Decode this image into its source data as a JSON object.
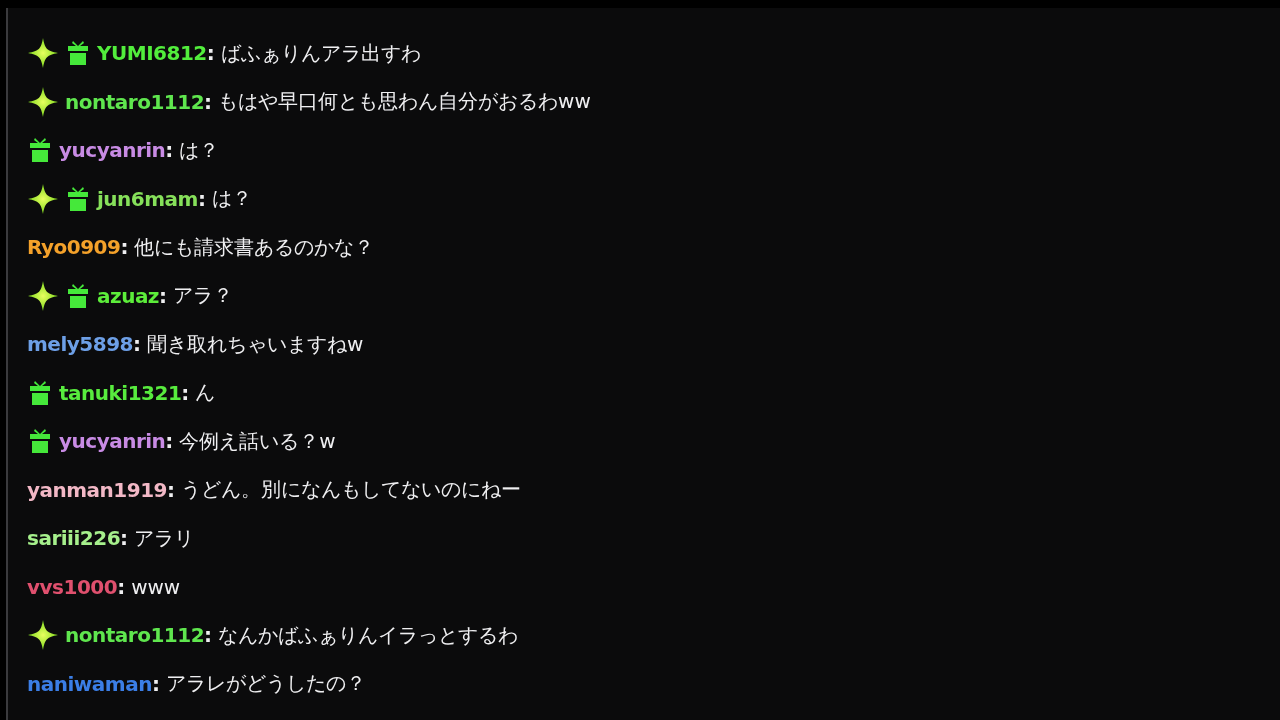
{
  "messages": [
    {
      "user": "YUMI6812",
      "color": "#52ee3c",
      "badges": [
        {
          "kind": "sparkle"
        },
        {
          "kind": "gift"
        }
      ],
      "separator": ":",
      "text": "ばふぁりんアラ出すわ"
    },
    {
      "user": "nontaro1112",
      "color": "#5fe64e",
      "badges": [
        {
          "kind": "sparkle"
        }
      ],
      "separator": ":",
      "text": "もはや早口何とも思わん自分がおるわww"
    },
    {
      "user": "yucyanrin",
      "color": "#c88be4",
      "badges": [
        {
          "kind": "gift"
        }
      ],
      "separator": ":",
      "text": "は？"
    },
    {
      "user": "jun6mam",
      "color": "#86e05a",
      "badges": [
        {
          "kind": "sparkle"
        },
        {
          "kind": "gift"
        }
      ],
      "separator": ":",
      "text": "は？"
    },
    {
      "user": "Ryo0909",
      "color": "#f4a12a",
      "separator": ":",
      "text": "他にも請求書あるのかな？"
    },
    {
      "user": "azuaz",
      "color": "#5ced3a",
      "badges": [
        {
          "kind": "sparkle"
        },
        {
          "kind": "gift"
        }
      ],
      "separator": ":",
      "text": "アラ？"
    },
    {
      "user": "mely5898",
      "color": "#6d9fe6",
      "separator": ":",
      "text": "聞き取れちゃいますねw"
    },
    {
      "user": "tanuki1321",
      "color": "#58ec3e",
      "badges": [
        {
          "kind": "gift"
        }
      ],
      "separator": ":",
      "text": "ん"
    },
    {
      "user": "yucyanrin",
      "color": "#c88be4",
      "badges": [
        {
          "kind": "gift"
        }
      ],
      "separator": ":",
      "text": "今例え話いる？w"
    },
    {
      "user": "yanman1919",
      "color": "#f2b8c6",
      "separator": ":",
      "text": "うどん。別になんもしてないのにねー"
    },
    {
      "user": "sariii226",
      "color": "#a6f08c",
      "separator": ":",
      "text": "アラリ"
    },
    {
      "user": "vvs1000",
      "color": "#e0506e",
      "separator": ":",
      "text": "www"
    },
    {
      "user": "nontaro1112",
      "color": "#5fe64e",
      "badges": [
        {
          "kind": "sparkle"
        }
      ],
      "separator": ":",
      "text": "なんかばふぁりんイラっとするわ"
    },
    {
      "user": "naniwaman",
      "color": "#3b7ee6",
      "separator": ":",
      "text": "アラレがどうしたの？"
    }
  ]
}
